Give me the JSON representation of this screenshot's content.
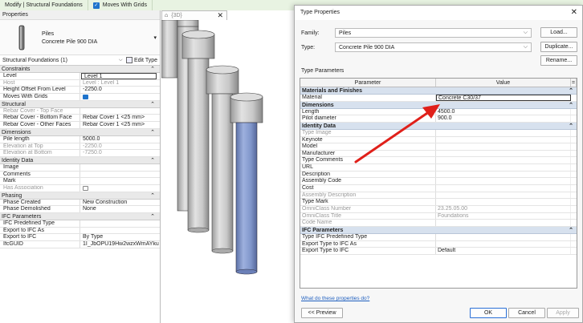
{
  "ribbon": {
    "context_tab": "Modify | Structural Foundations",
    "moves_with_grids": "Moves With Grids"
  },
  "properties": {
    "title": "Properties",
    "family": "Piles",
    "type": "Concrete Pile 900 DIA",
    "instance_selector": "Structural Foundations (1)",
    "edit_type": "Edit Type",
    "groups": [
      {
        "name": "Constraints",
        "rows": [
          {
            "k": "Level",
            "v": "Level 1",
            "dim": false,
            "boxed": true
          },
          {
            "k": "Host",
            "v": "Level : Level 1",
            "dim": true
          },
          {
            "k": "Height Offset From Level",
            "v": "-2250.0",
            "dim": false
          },
          {
            "k": "Moves With Grids",
            "v": "",
            "dim": false,
            "checkbox": "on"
          }
        ]
      },
      {
        "name": "Structural",
        "rows": [
          {
            "k": "Rebar Cover - Top Face",
            "v": "",
            "dim": true
          },
          {
            "k": "Rebar Cover - Bottom Face",
            "v": "Rebar Cover 1 <25 mm>",
            "dim": false
          },
          {
            "k": "Rebar Cover - Other Faces",
            "v": "Rebar Cover 1 <25 mm>",
            "dim": false
          }
        ]
      },
      {
        "name": "Dimensions",
        "rows": [
          {
            "k": "Pile length",
            "v": "5000.0",
            "dim": false
          },
          {
            "k": "Elevation at Top",
            "v": "-2250.0",
            "dim": true
          },
          {
            "k": "Elevation at Bottom",
            "v": "-7250.0",
            "dim": true
          }
        ]
      },
      {
        "name": "Identity Data",
        "rows": [
          {
            "k": "Image",
            "v": "",
            "dim": false
          },
          {
            "k": "Comments",
            "v": "",
            "dim": false
          },
          {
            "k": "Mark",
            "v": "",
            "dim": false
          },
          {
            "k": "Has Association",
            "v": "",
            "dim": true,
            "checkbox": "off"
          }
        ]
      },
      {
        "name": "Phasing",
        "rows": [
          {
            "k": "Phase Created",
            "v": "New Construction",
            "dim": false
          },
          {
            "k": "Phase Demolished",
            "v": "None",
            "dim": false
          }
        ]
      },
      {
        "name": "IFC Parameters",
        "rows": [
          {
            "k": "IFC Predefined Type",
            "v": "",
            "dim": false
          },
          {
            "k": "Export to IFC As",
            "v": "",
            "dim": false
          },
          {
            "k": "Export to IFC",
            "v": "By Type",
            "dim": false
          },
          {
            "k": "IfcGUID",
            "v": "1I_JbOPU19Hw2wzxWmAYku",
            "dim": false
          }
        ]
      }
    ]
  },
  "view": {
    "tab_label": "{3D}"
  },
  "dialog": {
    "title": "Type Properties",
    "family_label": "Family:",
    "family_value": "Piles",
    "type_label": "Type:",
    "type_value": "Concrete Pile 900 DIA",
    "load_btn": "Load...",
    "duplicate_btn": "Duplicate...",
    "rename_btn": "Rename...",
    "type_parameters_label": "Type Parameters",
    "col_parameter": "Parameter",
    "col_value": "Value",
    "col_sort": "=",
    "groups": [
      {
        "name": "Materials and Finishes",
        "rows": [
          {
            "k": "Material",
            "v": "Concrete C30/37",
            "sel": true
          }
        ]
      },
      {
        "name": "Dimensions",
        "rows": [
          {
            "k": "Length",
            "v": "4500.0"
          },
          {
            "k": "Pilot diameter",
            "v": "900.0"
          }
        ]
      },
      {
        "name": "Identity Data",
        "rows": [
          {
            "k": "Type Image",
            "v": "",
            "dim": true
          },
          {
            "k": "Keynote",
            "v": ""
          },
          {
            "k": "Model",
            "v": ""
          },
          {
            "k": "Manufacturer",
            "v": ""
          },
          {
            "k": "Type Comments",
            "v": ""
          },
          {
            "k": "URL",
            "v": ""
          },
          {
            "k": "Description",
            "v": ""
          },
          {
            "k": "Assembly Code",
            "v": ""
          },
          {
            "k": "Cost",
            "v": ""
          },
          {
            "k": "Assembly Description",
            "v": "",
            "dim": true
          },
          {
            "k": "Type Mark",
            "v": ""
          },
          {
            "k": "OmniClass Number",
            "v": "23.25.05.00",
            "dim": true
          },
          {
            "k": "OmniClass Title",
            "v": "Foundations",
            "dim": true
          },
          {
            "k": "Code Name",
            "v": "",
            "dim": true
          }
        ]
      },
      {
        "name": "IFC Parameters",
        "rows": [
          {
            "k": "Type IFC Predefined Type",
            "v": ""
          },
          {
            "k": "Export Type to IFC As",
            "v": ""
          },
          {
            "k": "Export Type to IFC",
            "v": "Default"
          }
        ]
      }
    ],
    "help_link": "What do these properties do?",
    "preview_btn": "<< Preview",
    "ok_btn": "OK",
    "cancel_btn": "Cancel",
    "apply_btn": "Apply",
    "colors": {
      "accent_blue": "#1f74cc",
      "group_header": "#d7e1ee",
      "arrow_red": "#e0201a",
      "pile_selected": "#7f95c8"
    }
  }
}
